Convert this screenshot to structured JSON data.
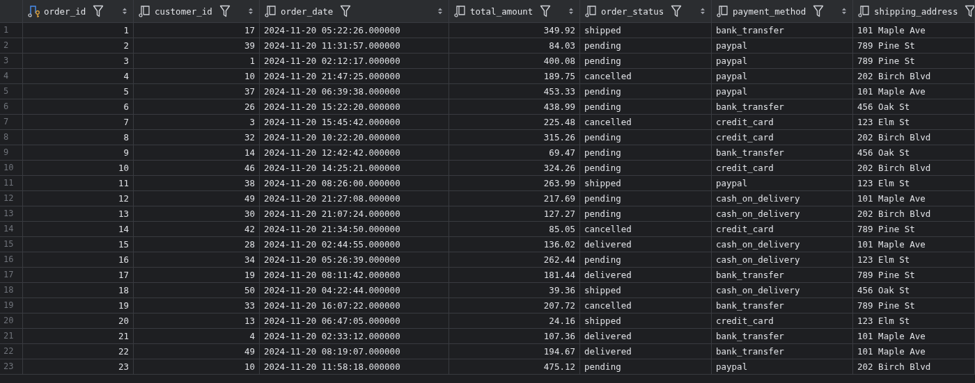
{
  "table": {
    "columns": [
      {
        "name": "order_id",
        "kind": "primary_key",
        "numeric": true,
        "sort_control": true
      },
      {
        "name": "customer_id",
        "kind": "column",
        "numeric": true,
        "sort_control": true
      },
      {
        "name": "order_date",
        "kind": "column",
        "numeric": false,
        "sort_control": true
      },
      {
        "name": "total_amount",
        "kind": "column",
        "numeric": true,
        "sort_control": true
      },
      {
        "name": "order_status",
        "kind": "column",
        "numeric": false,
        "sort_control": true
      },
      {
        "name": "payment_method",
        "kind": "column",
        "numeric": false,
        "sort_control": true
      },
      {
        "name": "shipping_address",
        "kind": "column",
        "numeric": false
      }
    ],
    "rows": [
      {
        "number": "1",
        "cells": [
          "1",
          "17",
          "2024-11-20 05:22:26.000000",
          "349.92",
          "shipped",
          "bank_transfer",
          "101 Maple Ave"
        ]
      },
      {
        "number": "2",
        "cells": [
          "2",
          "39",
          "2024-11-20 11:31:57.000000",
          "84.03",
          "pending",
          "paypal",
          "789 Pine St"
        ]
      },
      {
        "number": "3",
        "cells": [
          "3",
          "1",
          "2024-11-20 02:12:17.000000",
          "400.08",
          "pending",
          "paypal",
          "789 Pine St"
        ]
      },
      {
        "number": "4",
        "cells": [
          "4",
          "10",
          "2024-11-20 21:47:25.000000",
          "189.75",
          "cancelled",
          "paypal",
          "202 Birch Blvd"
        ]
      },
      {
        "number": "5",
        "cells": [
          "5",
          "37",
          "2024-11-20 06:39:38.000000",
          "453.33",
          "pending",
          "paypal",
          "101 Maple Ave"
        ]
      },
      {
        "number": "6",
        "cells": [
          "6",
          "26",
          "2024-11-20 15:22:20.000000",
          "438.99",
          "pending",
          "bank_transfer",
          "456 Oak St"
        ]
      },
      {
        "number": "7",
        "cells": [
          "7",
          "3",
          "2024-11-20 15:45:42.000000",
          "225.48",
          "cancelled",
          "credit_card",
          "123 Elm St"
        ]
      },
      {
        "number": "8",
        "cells": [
          "8",
          "32",
          "2024-11-20 10:22:20.000000",
          "315.26",
          "pending",
          "credit_card",
          "202 Birch Blvd"
        ]
      },
      {
        "number": "9",
        "cells": [
          "9",
          "14",
          "2024-11-20 12:42:42.000000",
          "69.47",
          "pending",
          "bank_transfer",
          "456 Oak St"
        ]
      },
      {
        "number": "10",
        "cells": [
          "10",
          "46",
          "2024-11-20 14:25:21.000000",
          "324.26",
          "pending",
          "credit_card",
          "202 Birch Blvd"
        ]
      },
      {
        "number": "11",
        "cells": [
          "11",
          "38",
          "2024-11-20 08:26:00.000000",
          "263.99",
          "shipped",
          "paypal",
          "123 Elm St"
        ]
      },
      {
        "number": "12",
        "cells": [
          "12",
          "49",
          "2024-11-20 21:27:08.000000",
          "217.69",
          "pending",
          "cash_on_delivery",
          "101 Maple Ave"
        ]
      },
      {
        "number": "13",
        "cells": [
          "13",
          "30",
          "2024-11-20 21:07:24.000000",
          "127.27",
          "pending",
          "cash_on_delivery",
          "202 Birch Blvd"
        ]
      },
      {
        "number": "14",
        "cells": [
          "14",
          "42",
          "2024-11-20 21:34:50.000000",
          "85.05",
          "cancelled",
          "credit_card",
          "789 Pine St"
        ]
      },
      {
        "number": "15",
        "cells": [
          "15",
          "28",
          "2024-11-20 02:44:55.000000",
          "136.02",
          "delivered",
          "cash_on_delivery",
          "101 Maple Ave"
        ]
      },
      {
        "number": "16",
        "cells": [
          "16",
          "34",
          "2024-11-20 05:26:39.000000",
          "262.44",
          "pending",
          "cash_on_delivery",
          "123 Elm St"
        ]
      },
      {
        "number": "17",
        "cells": [
          "17",
          "19",
          "2024-11-20 08:11:42.000000",
          "181.44",
          "delivered",
          "bank_transfer",
          "789 Pine St"
        ]
      },
      {
        "number": "18",
        "cells": [
          "18",
          "50",
          "2024-11-20 04:22:44.000000",
          "39.36",
          "shipped",
          "cash_on_delivery",
          "456 Oak St"
        ]
      },
      {
        "number": "19",
        "cells": [
          "19",
          "33",
          "2024-11-20 16:07:22.000000",
          "207.72",
          "cancelled",
          "bank_transfer",
          "789 Pine St"
        ]
      },
      {
        "number": "20",
        "cells": [
          "20",
          "13",
          "2024-11-20 06:47:05.000000",
          "24.16",
          "shipped",
          "credit_card",
          "123 Elm St"
        ]
      },
      {
        "number": "21",
        "cells": [
          "21",
          "4",
          "2024-11-20 02:33:12.000000",
          "107.36",
          "delivered",
          "bank_transfer",
          "101 Maple Ave"
        ]
      },
      {
        "number": "22",
        "cells": [
          "22",
          "49",
          "2024-11-20 08:19:07.000000",
          "194.67",
          "delivered",
          "bank_transfer",
          "101 Maple Ave"
        ]
      },
      {
        "number": "23",
        "cells": [
          "23",
          "10",
          "2024-11-20 11:58:18.000000",
          "475.12",
          "pending",
          "paypal",
          "202 Birch Blvd"
        ]
      }
    ]
  }
}
